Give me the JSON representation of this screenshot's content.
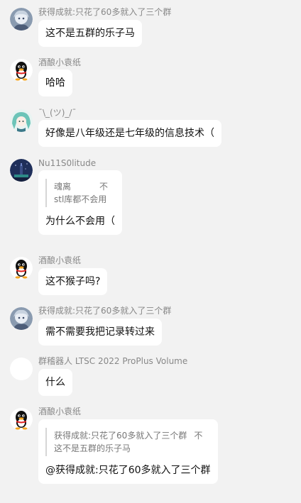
{
  "messages": [
    {
      "sender": "获得成就:只花了60多就入了三个群",
      "avatar_icon": "anime-girl-avatar-icon",
      "text": "这不是五群的乐子马"
    },
    {
      "sender": "酒酿小袁纸",
      "avatar_icon": "qq-penguin-avatar-icon",
      "text": "哈哈"
    },
    {
      "sender": "¯\\_(ツ)_/¯",
      "avatar_icon": "chibi-teal-hair-avatar-icon",
      "text": "好像是八年级还是七年级的信息技术（"
    },
    {
      "sender": "Nu11S0litude",
      "avatar_icon": "night-tower-avatar-icon",
      "quote": {
        "author": "魂离",
        "tag": "不",
        "text": "stl库都不会用"
      },
      "text": "为什么不会用（"
    },
    {
      "sender": "酒酿小袁纸",
      "avatar_icon": "qq-penguin-avatar-icon",
      "text": "这不猴子吗?"
    },
    {
      "sender": "获得成就:只花了60多就入了三个群",
      "avatar_icon": "anime-girl-avatar-icon",
      "text": "需不需要我把记录转过来"
    },
    {
      "sender": "群稽器人 LTSC 2022 ProPlus Volume",
      "avatar_icon": "blank-avatar-icon",
      "text": "什么"
    },
    {
      "sender": "酒酿小袁纸",
      "avatar_icon": "qq-penguin-avatar-icon",
      "quote": {
        "author": "获得成就:只花了60多就入了三个群",
        "tag": "不",
        "text": "这不是五群的乐子马"
      },
      "text": "@获得成就:只花了60多就入了三个群"
    }
  ]
}
